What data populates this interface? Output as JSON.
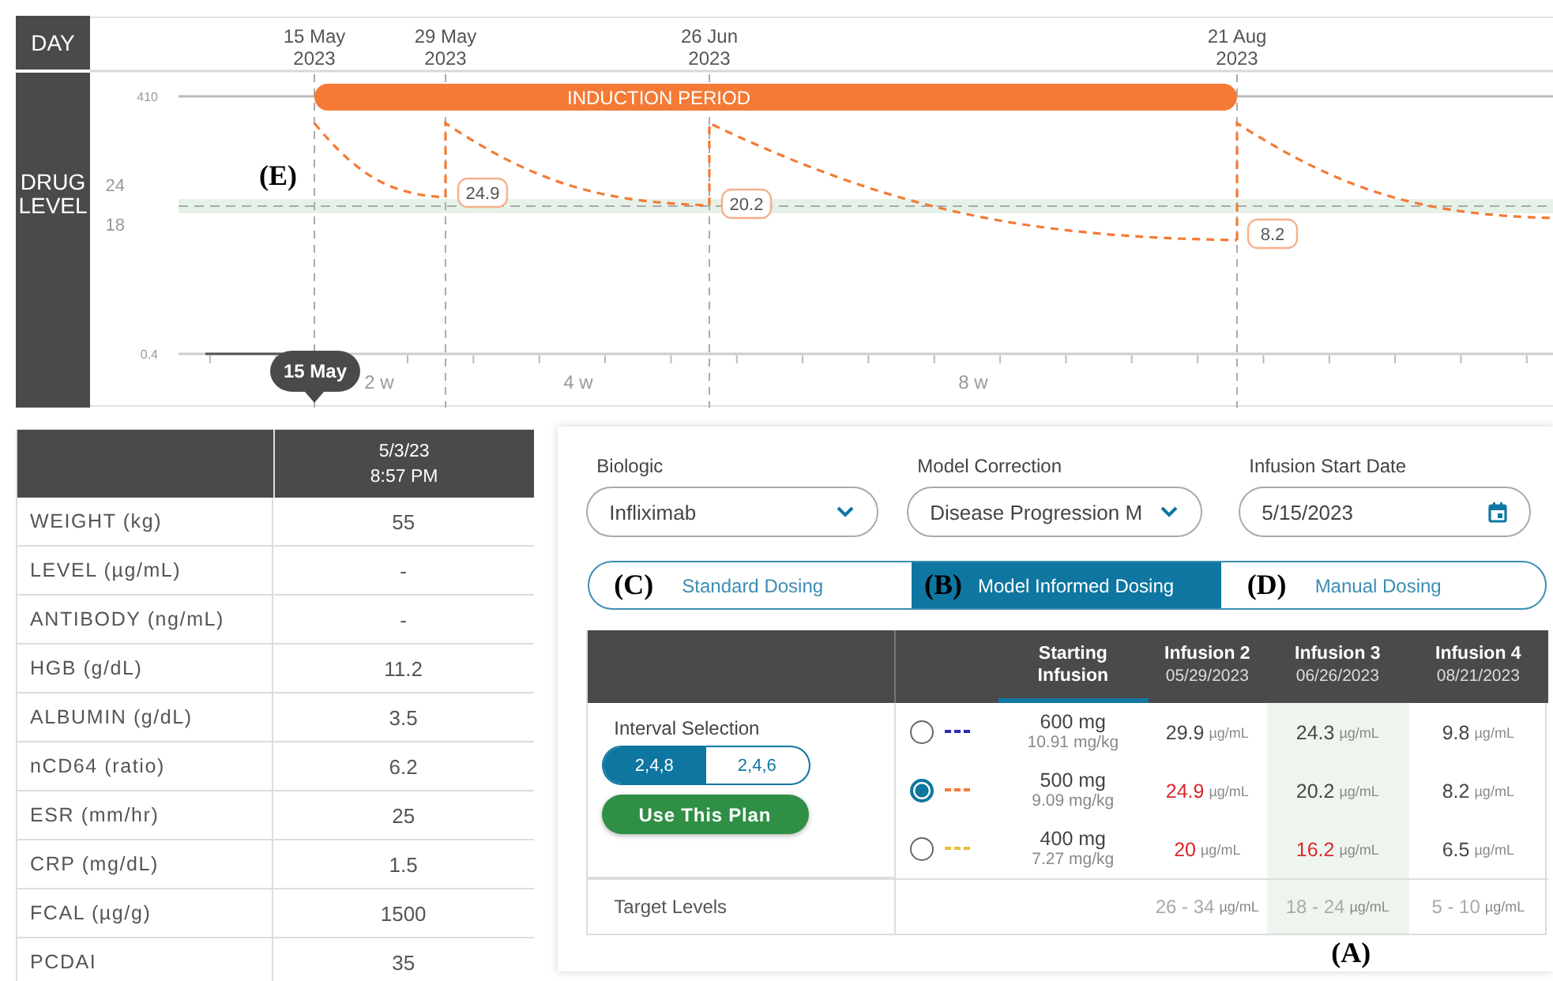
{
  "chart": {
    "row_label": "DAY",
    "axis_label": "DRUG LEVEL",
    "dates": [
      {
        "day": "15 May",
        "year": "2023"
      },
      {
        "day": "29 May",
        "year": "2023"
      },
      {
        "day": "26 Jun",
        "year": "2023"
      },
      {
        "day": "21 Aug",
        "year": "2023"
      }
    ],
    "y_labels": [
      "410",
      "24",
      "18",
      "0.4"
    ],
    "period": "INDUCTION PERIOD",
    "troughs": [
      "24.9",
      "20.2",
      "8.2"
    ],
    "spans": [
      "2 w",
      "4 w",
      "8 w"
    ],
    "tooltip": "15 May",
    "annotation": "(E)"
  },
  "labs": {
    "header": [
      "5/3/23",
      "8:57 PM"
    ],
    "rows": [
      {
        "name": "WEIGHT (kg)",
        "value": "55"
      },
      {
        "name": "LEVEL (µg/mL)",
        "value": "-"
      },
      {
        "name": "ANTIBODY (ng/mL)",
        "value": "-"
      },
      {
        "name": "HGB (g/dL)",
        "value": "11.2"
      },
      {
        "name": "ALBUMIN (g/dL)",
        "value": "3.5"
      },
      {
        "name": "nCD64 (ratio)",
        "value": "6.2"
      },
      {
        "name": "ESR (mm/hr)",
        "value": "25"
      },
      {
        "name": "CRP (mg/dL)",
        "value": "1.5"
      },
      {
        "name": "FCAL (µg/g)",
        "value": "1500"
      },
      {
        "name": "PCDAI",
        "value": "35"
      }
    ]
  },
  "plan": {
    "fields": [
      {
        "label": "Biologic",
        "value": "Infliximab",
        "kind": "select"
      },
      {
        "label": "Model Correction",
        "value": "Disease Progression M",
        "kind": "select"
      },
      {
        "label": "Infusion Start Date",
        "value": "5/15/2023",
        "kind": "date"
      }
    ],
    "tabs": [
      {
        "annotation": "(C)",
        "label": "Standard Dosing",
        "selected": false
      },
      {
        "annotation": "(B)",
        "label": "Model Informed Dosing",
        "selected": true
      },
      {
        "annotation": "(D)",
        "label": "Manual Dosing",
        "selected": false
      }
    ],
    "dosing": {
      "columns": [
        {
          "title": "Starting Infusion",
          "selected": true,
          "highlighted": false
        },
        {
          "title": "Infusion 2",
          "date": "05/29/2023",
          "selected": false,
          "highlighted": false
        },
        {
          "title": "Infusion 3",
          "date": "06/26/2023",
          "selected": false,
          "highlighted": true
        },
        {
          "title": "Infusion 4",
          "date": "08/21/2023",
          "selected": false,
          "highlighted": false
        }
      ],
      "interval": {
        "label": "Interval Selection",
        "options": [
          {
            "label": "2,4,8",
            "selected": true
          },
          {
            "label": "2,4,6",
            "selected": false
          }
        ]
      },
      "button": "Use This Plan",
      "options": [
        {
          "selected": false,
          "color": "#2b2bb5",
          "dose": "600 mg",
          "per_kg": "10.91 mg/kg",
          "levels": [
            {
              "value": "29.9",
              "unit": "µg/mL",
              "below_target": false
            },
            {
              "value": "24.3",
              "unit": "µg/mL",
              "below_target": false
            },
            {
              "value": "9.8",
              "unit": "µg/mL",
              "below_target": false
            }
          ]
        },
        {
          "selected": true,
          "color": "#f47a3c",
          "dose": "500 mg",
          "per_kg": "9.09 mg/kg",
          "levels": [
            {
              "value": "24.9",
              "unit": "µg/mL",
              "below_target": true
            },
            {
              "value": "20.2",
              "unit": "µg/mL",
              "below_target": false
            },
            {
              "value": "8.2",
              "unit": "µg/mL",
              "below_target": false
            }
          ]
        },
        {
          "selected": false,
          "color": "#e8c040",
          "dose": "400 mg",
          "per_kg": "7.27 mg/kg",
          "levels": [
            {
              "value": "20",
              "unit": "µg/mL",
              "below_target": true
            },
            {
              "value": "16.2",
              "unit": "µg/mL",
              "below_target": true
            },
            {
              "value": "6.5",
              "unit": "µg/mL",
              "below_target": false
            }
          ]
        }
      ],
      "target": {
        "label": "Target Levels",
        "levels": [
          {
            "value": "26 - 34",
            "unit": "µg/mL"
          },
          {
            "value": "18 - 24",
            "unit": "µg/mL"
          },
          {
            "value": "5 - 10",
            "unit": "µg/mL"
          }
        ]
      },
      "annotation": "(A)"
    }
  }
}
